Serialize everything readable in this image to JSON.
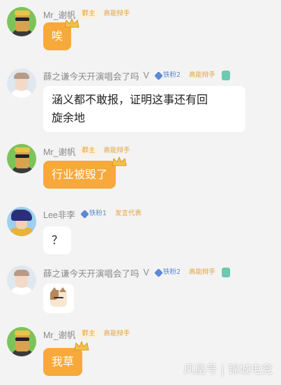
{
  "messages": [
    {
      "username": "Mr_谢帆",
      "badges": [
        "群主",
        "高能辩手"
      ],
      "text": "唉"
    },
    {
      "username": "薛之谦今天开演唱会了吗",
      "verified_mark": "V",
      "fan_badge": "铁粉2",
      "badges": [
        "高能辩手"
      ],
      "text_line1": "涵义都不敢报，证明这事还有回",
      "text_line2": "旋余地"
    },
    {
      "username": "Mr_谢帆",
      "badges": [
        "群主",
        "高能辩手"
      ],
      "text": "行业被毁了"
    },
    {
      "username": "Lee非李",
      "fan_badge": "铁粉1",
      "badges": [
        "发言代表"
      ],
      "text": "？"
    },
    {
      "username": "薛之谦今天开演唱会了吗",
      "verified_mark": "V",
      "fan_badge": "铁粉2",
      "badges": [
        "高能辩手"
      ],
      "sticker": "cat-face"
    },
    {
      "username": "Mr_谢帆",
      "badges": [
        "群主",
        "高能辩手"
      ],
      "text": "我草"
    }
  ],
  "watermark": "凤凰号 | 锦城电竞",
  "colors": {
    "background": "#f3f3f3",
    "owner_bubble": "#f7a93a",
    "other_bubble": "#ffffff",
    "badge_text": "#e6a23c",
    "fan_badge": "#5b8ad6"
  }
}
